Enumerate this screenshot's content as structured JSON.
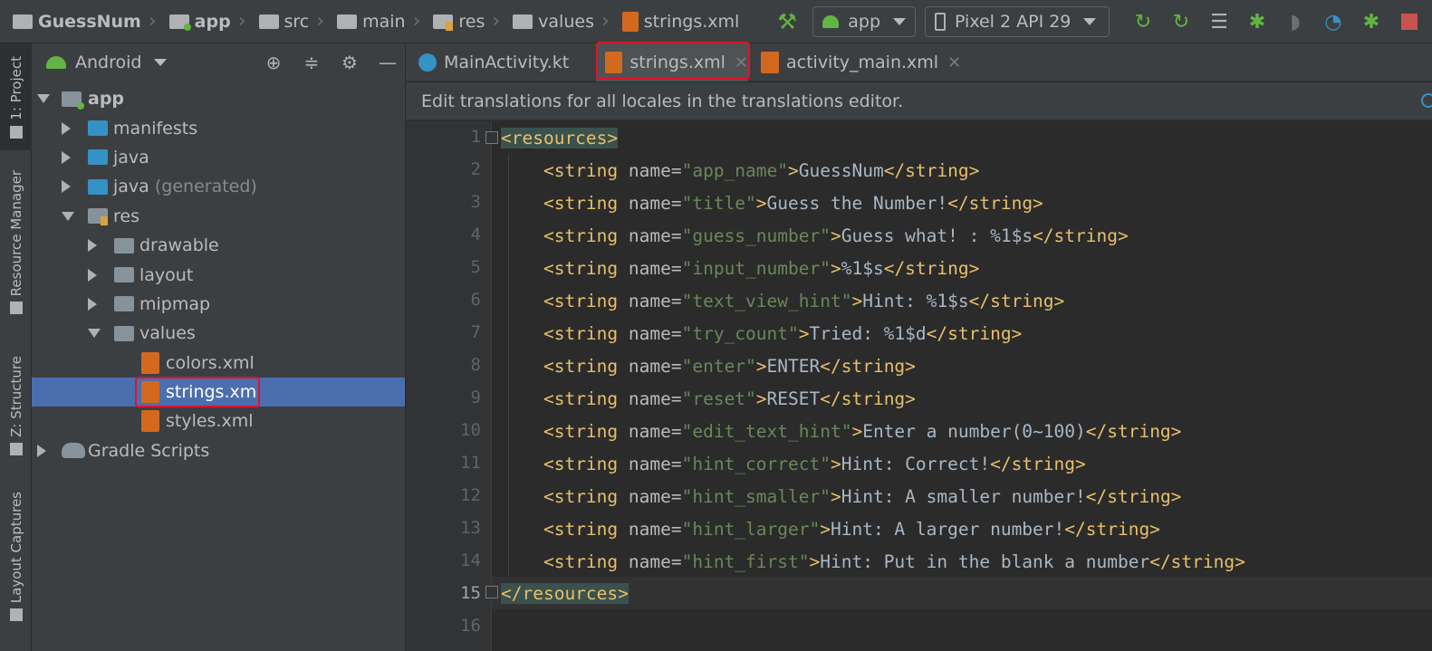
{
  "breadcrumb": [
    {
      "label": "GuessNum",
      "bold": true
    },
    {
      "label": "app",
      "bold": true
    },
    {
      "label": "src",
      "bold": false
    },
    {
      "label": "main",
      "bold": false
    },
    {
      "label": "res",
      "bold": false
    },
    {
      "label": "values",
      "bold": false
    },
    {
      "label": "strings.xml",
      "bold": false
    }
  ],
  "toolbar": {
    "run_config": "app",
    "device": "Pixel 2 API 29",
    "icons": [
      "hammer-icon",
      "rerun-icon",
      "apply-changes-icon",
      "apply-code-changes-icon",
      "debug-icon",
      "attach-debugger-icon",
      "profile-icon",
      "debug-app-icon",
      "stop-icon"
    ]
  },
  "tool_strip": {
    "project": "1: Project",
    "resource_manager": "Resource Manager",
    "structure": "Z: Structure",
    "layout_captures": "Layout Captures"
  },
  "project_panel": {
    "view_mode": "Android",
    "tree": {
      "app": "app",
      "manifests": "manifests",
      "java": "java",
      "java_generated": "java",
      "java_generated_suffix": "(generated)",
      "res": "res",
      "drawable": "drawable",
      "layout": "layout",
      "mipmap": "mipmap",
      "values": "values",
      "colors": "colors.xml",
      "strings": "strings.xml",
      "styles": "styles.xml",
      "gradle": "Gradle Scripts"
    }
  },
  "tabs": [
    {
      "label": "MainActivity.kt",
      "active": false
    },
    {
      "label": "strings.xml",
      "active": true
    },
    {
      "label": "activity_main.xml",
      "active": false
    }
  ],
  "banner": "Edit translations for all locales in the translations editor.",
  "editor": {
    "current_line": 15,
    "line_numbers": [
      "1",
      "2",
      "3",
      "4",
      "5",
      "6",
      "7",
      "8",
      "9",
      "10",
      "11",
      "12",
      "13",
      "14",
      "15",
      "16"
    ],
    "root_open": "<resources>",
    "root_close": "</resources>",
    "strings": [
      {
        "name": "app_name",
        "value": "GuessNum"
      },
      {
        "name": "title",
        "value": "Guess the Number!"
      },
      {
        "name": "guess_number",
        "value": "Guess what! : %1$s"
      },
      {
        "name": "input_number",
        "value": "%1$s"
      },
      {
        "name": "text_view_hint",
        "value": "Hint: %1$s"
      },
      {
        "name": "try_count",
        "value": "Tried: %1$d"
      },
      {
        "name": "enter",
        "value": "ENTER"
      },
      {
        "name": "reset",
        "value": "RESET"
      },
      {
        "name": "edit_text_hint",
        "value": "Enter a number(0~100)"
      },
      {
        "name": "hint_correct",
        "value": "Hint: Correct!"
      },
      {
        "name": "hint_smaller",
        "value": "Hint: A smaller number!"
      },
      {
        "name": "hint_larger",
        "value": "Hint: A larger number!"
      },
      {
        "name": "hint_first",
        "value": "Hint: Put in the blank a number"
      }
    ]
  }
}
